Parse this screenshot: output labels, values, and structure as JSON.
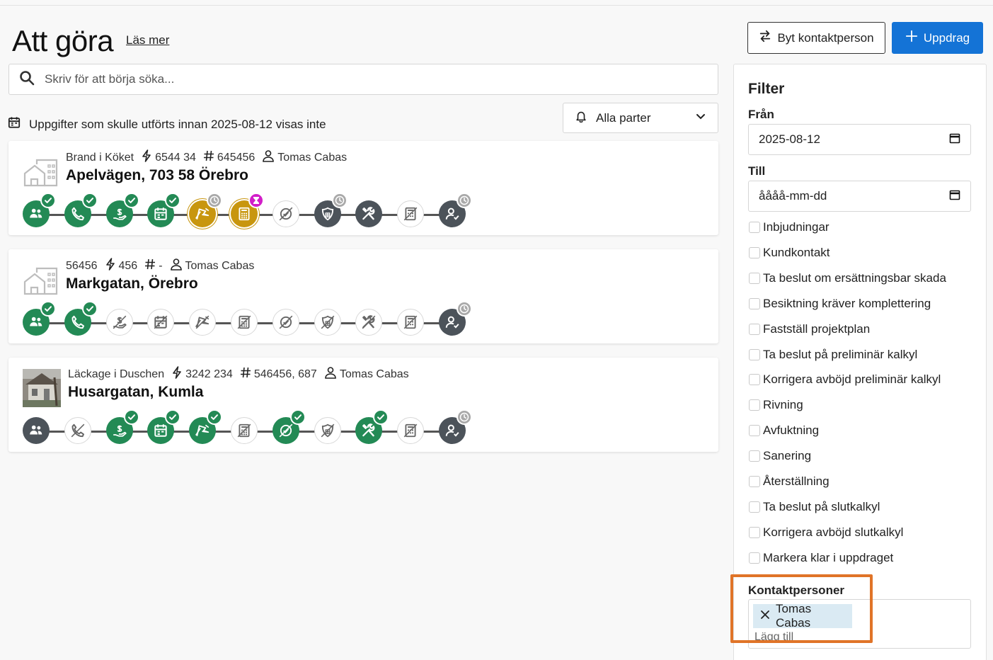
{
  "header": {
    "title": "Att göra",
    "read_more": "Läs mer",
    "switch_contact_label": "Byt kontaktperson",
    "new_assignment_label": "Uppdrag"
  },
  "search": {
    "placeholder": "Skriv för att börja söka..."
  },
  "notice": {
    "text": "Uppgifter som skulle utförts innan 2025-08-12 visas inte"
  },
  "party_select": {
    "value": "Alla parter"
  },
  "colors": {
    "primary": "#1473d6",
    "done": "#238a55",
    "dark": "#4c535a",
    "gold": "#c8960f",
    "pending_badge": "#d21ec8",
    "highlight": "#e07428"
  },
  "cards": [
    {
      "name": "Brand i Köket",
      "claim": "6544 34",
      "ref": "645456",
      "person": "Tomas Cabas",
      "address": "Apelvägen, 703 58 Örebro",
      "thumb": "house-icon",
      "steps": [
        {
          "icon": "people-icon",
          "state": "done",
          "badge": "check"
        },
        {
          "icon": "phone-icon",
          "state": "done",
          "badge": "check"
        },
        {
          "icon": "hand-money-icon",
          "state": "done",
          "badge": "check"
        },
        {
          "icon": "calendar-icon",
          "state": "done",
          "badge": "check"
        },
        {
          "icon": "flag-icon",
          "state": "gold",
          "badge": "clock"
        },
        {
          "icon": "calculator-icon",
          "state": "gold",
          "badge": "hourglass"
        },
        {
          "icon": "check-off-icon",
          "state": "empty",
          "badge": "none"
        },
        {
          "icon": "shield-icon",
          "state": "dark",
          "badge": "clock"
        },
        {
          "icon": "tools-icon",
          "state": "dark",
          "badge": "none"
        },
        {
          "icon": "calculator-off-icon",
          "state": "empty",
          "badge": "none"
        },
        {
          "icon": "user-check-icon",
          "state": "dark",
          "badge": "clock"
        }
      ]
    },
    {
      "name": "56456",
      "claim": "456",
      "ref": "-",
      "person": "Tomas Cabas",
      "address": "Markgatan, Örebro",
      "thumb": "house-icon",
      "steps": [
        {
          "icon": "people-icon",
          "state": "done",
          "badge": "check"
        },
        {
          "icon": "phone-icon",
          "state": "done",
          "badge": "check"
        },
        {
          "icon": "hand-money-icon",
          "state": "empty",
          "badge": "none"
        },
        {
          "icon": "calendar-icon",
          "state": "empty",
          "badge": "none"
        },
        {
          "icon": "flag-icon",
          "state": "empty",
          "badge": "none"
        },
        {
          "icon": "calculator-icon",
          "state": "empty",
          "badge": "none"
        },
        {
          "icon": "check-off-icon",
          "state": "empty",
          "badge": "none"
        },
        {
          "icon": "shield-icon",
          "state": "empty",
          "badge": "none"
        },
        {
          "icon": "tools-icon",
          "state": "empty",
          "badge": "none"
        },
        {
          "icon": "calculator-off-icon",
          "state": "empty",
          "badge": "none"
        },
        {
          "icon": "user-check-icon",
          "state": "dark",
          "badge": "clock"
        }
      ]
    },
    {
      "name": "Läckage i Duschen",
      "claim": "3242 234",
      "ref": "546456, 687",
      "person": "Tomas Cabas",
      "address": "Husargatan, Kumla",
      "thumb": "property-photo",
      "steps": [
        {
          "icon": "people-icon",
          "state": "dark",
          "badge": "none"
        },
        {
          "icon": "phone-icon",
          "state": "empty",
          "badge": "none"
        },
        {
          "icon": "hand-money-icon",
          "state": "done",
          "badge": "check"
        },
        {
          "icon": "calendar-icon",
          "state": "done",
          "badge": "check"
        },
        {
          "icon": "flag-icon",
          "state": "done",
          "badge": "check"
        },
        {
          "icon": "calculator-icon",
          "state": "empty",
          "badge": "none"
        },
        {
          "icon": "check-off-icon",
          "state": "done",
          "badge": "check"
        },
        {
          "icon": "shield-icon",
          "state": "empty",
          "badge": "none"
        },
        {
          "icon": "tools-icon",
          "state": "done",
          "badge": "check"
        },
        {
          "icon": "calculator-off-icon",
          "state": "empty",
          "badge": "none"
        },
        {
          "icon": "user-check-icon",
          "state": "dark",
          "badge": "clock"
        }
      ]
    }
  ],
  "filter": {
    "title": "Filter",
    "from_label": "Från",
    "from_value": "2025-08-12",
    "to_label": "Till",
    "to_value": "åååå-mm-dd",
    "checkboxes": [
      "Inbjudningar",
      "Kundkontakt",
      "Ta beslut om ersättningsbar skada",
      "Besiktning kräver komplettering",
      "Fastställ projektplan",
      "Ta beslut på preliminär kalkyl",
      "Korrigera avböjd preliminär kalkyl",
      "Rivning",
      "Avfuktning",
      "Sanering",
      "Återställning",
      "Ta beslut på slutkalkyl",
      "Korrigera avböjd slutkalkyl",
      "Markera klar i uppdraget"
    ],
    "contacts_label": "Kontaktpersoner",
    "contact_chip": "Tomas Cabas",
    "add_placeholder": "Lägg till"
  }
}
